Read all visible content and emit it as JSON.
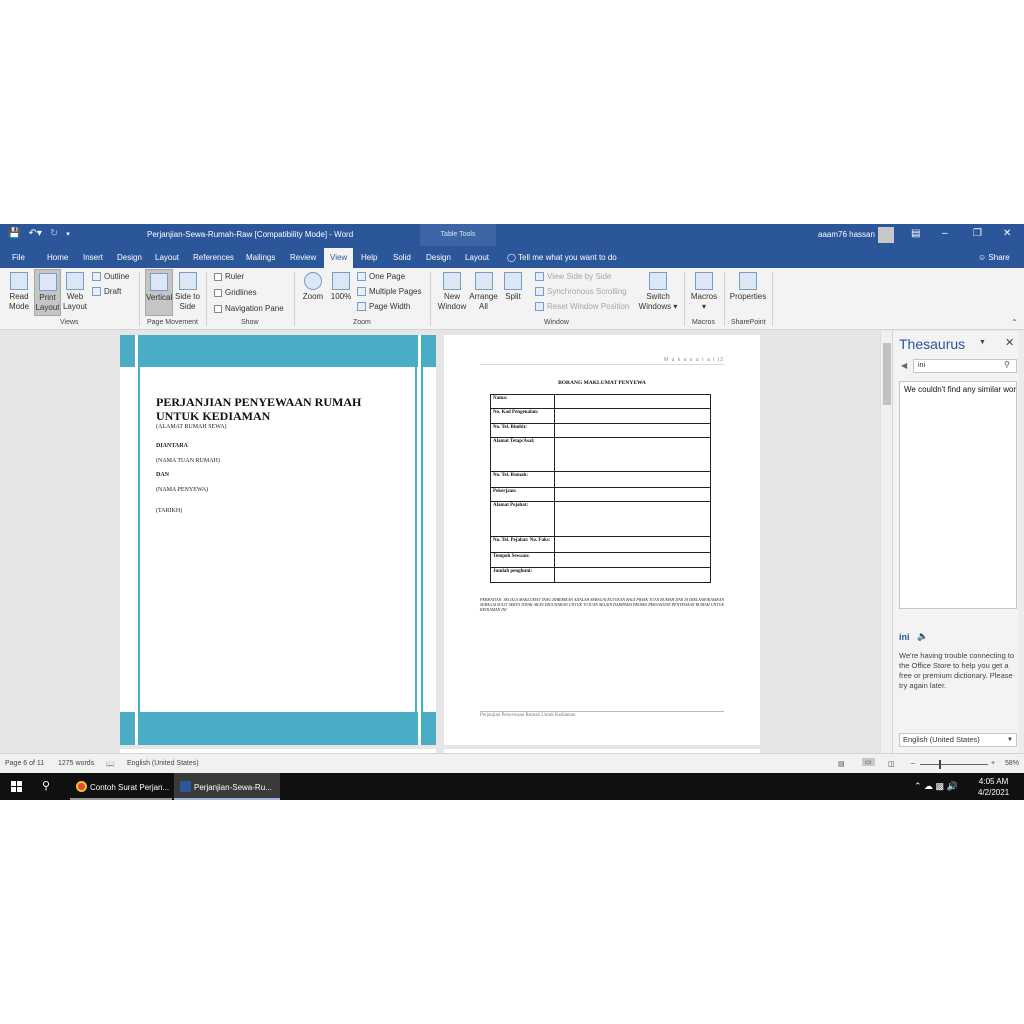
{
  "titlebar": {
    "doc_title": "Perjanjian-Sewa-Rumah-Raw [Compatibility Mode]  -  Word",
    "context_group": "Table Tools",
    "user": "aaam76 hassan"
  },
  "tabs": {
    "file": "File",
    "home": "Home",
    "insert": "Insert",
    "design": "Design",
    "layout": "Layout",
    "references": "References",
    "mailings": "Mailings",
    "review": "Review",
    "view": "View",
    "help": "Help",
    "solid": "Solid",
    "table_design": "Design",
    "table_layout": "Layout",
    "tell_me": "Tell me what you want to do",
    "share": "Share"
  },
  "ribbon": {
    "read_mode": "Read Mode",
    "print_layout": "Print Layout",
    "web_layout": "Web Layout",
    "outline": "Outline",
    "draft": "Draft",
    "views_group": "Views",
    "vertical": "Vertical",
    "side_to_side": "Side to Side",
    "page_movement_group": "Page Movement",
    "ruler": "Ruler",
    "gridlines": "Gridlines",
    "navigation_pane": "Navigation Pane",
    "show_group": "Show",
    "zoom": "Zoom",
    "zoom_100": "100%",
    "one_page": "One Page",
    "multiple_pages": "Multiple Pages",
    "page_width": "Page Width",
    "zoom_group": "Zoom",
    "new_window": "New Window",
    "arrange_all": "Arrange All",
    "split": "Split",
    "view_side_by_side": "View Side by Side",
    "synchronous_scrolling": "Synchronous Scrolling",
    "reset_window_position": "Reset Window Position",
    "switch_windows": "Switch Windows",
    "window_group": "Window",
    "macros": "Macros",
    "macros_group": "Macros",
    "properties": "Properties",
    "sharepoint_group": "SharePoint"
  },
  "cover": {
    "title": "PERJANJIAN PENYEWAAN RUMAH UNTUK KEDIAMAN",
    "address": "(ALAMAT RUMAH SEWA)",
    "between": "DIANTARA",
    "landlord": "(NAMA TUAN RUMAH)",
    "and": "DAN",
    "tenant": "(NAMA PENYEWA)",
    "date": "(TARIKH)"
  },
  "form_page": {
    "header": "M u k a s u r a t  |2",
    "title": "BORANG MAKLUMAT PENYEWA",
    "rows": [
      "Nama:",
      "No. Kad Pengenalan:",
      "No. Tel. Bimbit:",
      "Alamat Tetap/Asal:",
      "No. Tel. Rumah:",
      "Pekerjaan:",
      "Alamat Pejabat:",
      "No. Tel. Pejabat: No. Faks:",
      "Tempoh Sewaan:",
      "Jumlah penghuni:"
    ],
    "note": "PERHATIAN: SEGALA MAKLUMAT YANG DIBERIKAN ADALAH SEBAGAI RUJUKAN BAGI PIHAK TUAN RUMAH DAN IA DIKLASIFIKASIKAN SEBAGAI SULIT SERTA TIDAK AKAN DIGUNAKAN UNTUK TUJUAN SELAIN DARIPADA PROSES PERJANJIAN PENYEWAAN RUMAH UNTUK KEDIAMAN INI",
    "footer": "Perjanjian Penyewaan Rumah Untuk Kediaman"
  },
  "thesaurus": {
    "title": "Thesaurus",
    "search_value": "ini",
    "results_msg": "We couldn't find any similar words",
    "word": "ini",
    "error_msg": "We're having trouble connecting to the Office Store to help you get a free or premium dictionary. Please try again later.",
    "language": "English (United States)"
  },
  "status": {
    "page": "Page 6 of 11",
    "words": "1275 words",
    "language": "English (United States)",
    "zoom": "58%"
  },
  "taskbar": {
    "chrome_task": "Contoh Surat Perjan...",
    "word_task": "Perjanjian-Sewa-Ru...",
    "time": "4:05 AM",
    "date": "4/2/2021"
  },
  "colors": {
    "word_blue": "#2b579a",
    "cover_band": "#4bacc6"
  }
}
